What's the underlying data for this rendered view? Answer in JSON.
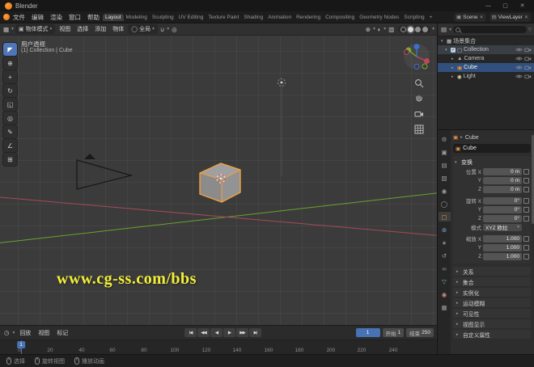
{
  "titlebar": {
    "app_title": "Blender",
    "minimize_glyph": "—",
    "maximize_glyph": "▢",
    "close_glyph": "✕"
  },
  "topbar": {
    "menus": [
      {
        "label": "文件"
      },
      {
        "label": "编辑"
      },
      {
        "label": "渲染"
      },
      {
        "label": "窗口"
      },
      {
        "label": "帮助"
      }
    ],
    "workspaces": [
      {
        "label": "Layout"
      },
      {
        "label": "Modeling"
      },
      {
        "label": "Sculpting"
      },
      {
        "label": "UV Editing"
      },
      {
        "label": "Texture Paint"
      },
      {
        "label": "Shading"
      },
      {
        "label": "Animation"
      },
      {
        "label": "Rendering"
      },
      {
        "label": "Compositing"
      },
      {
        "label": "Geometry Nodes"
      },
      {
        "label": "Scripting"
      }
    ],
    "active_workspace": "Layout",
    "add_workspace_glyph": "+",
    "scene_label": "Scene",
    "view_layer_label": "ViewLayer"
  },
  "viewport_header": {
    "mode_label": "物体模式",
    "menus": [
      {
        "label": "视图"
      },
      {
        "label": "选择"
      },
      {
        "label": "添加"
      },
      {
        "label": "物体"
      }
    ],
    "orientation_label": "全局"
  },
  "toolbar": {
    "tools": [
      {
        "name": "select-box",
        "glyph": "◤"
      },
      {
        "name": "cursor",
        "glyph": "⊕"
      },
      {
        "name": "move",
        "glyph": "+"
      },
      {
        "name": "rotate",
        "glyph": "↻"
      },
      {
        "name": "scale",
        "glyph": "◱"
      },
      {
        "name": "transform",
        "glyph": "◎"
      },
      {
        "name": "annotate",
        "glyph": "✎"
      },
      {
        "name": "measure",
        "glyph": "∠"
      },
      {
        "name": "add-primitive",
        "glyph": "⊞"
      }
    ]
  },
  "viewport": {
    "view_label": "用户透视",
    "context_label": "(1) Collection | Cube",
    "watermark": "www.cg-ss.com/bbs"
  },
  "outliner": {
    "rows": [
      {
        "label": "场景集合",
        "glyph": "▦"
      },
      {
        "label": "Collection",
        "glyph": "▢"
      },
      {
        "label": "Camera",
        "glyph": "▲"
      },
      {
        "label": "Cube",
        "glyph": "▣"
      },
      {
        "label": "Light",
        "glyph": "◉"
      }
    ]
  },
  "properties": {
    "tabs": [
      {
        "name": "tool",
        "glyph": "⚙"
      },
      {
        "name": "render",
        "glyph": "▣"
      },
      {
        "name": "output",
        "glyph": "▤"
      },
      {
        "name": "view-layer",
        "glyph": "▧"
      },
      {
        "name": "scene",
        "glyph": "◉"
      },
      {
        "name": "world",
        "glyph": "◯"
      },
      {
        "name": "object",
        "glyph": "▢"
      },
      {
        "name": "modifiers",
        "glyph": "⊛"
      },
      {
        "name": "particles",
        "glyph": "∗"
      },
      {
        "name": "physics",
        "glyph": "↺"
      },
      {
        "name": "constraints",
        "glyph": "∞"
      },
      {
        "name": "object-data",
        "glyph": "▽"
      },
      {
        "name": "material",
        "glyph": "◉"
      },
      {
        "name": "texture",
        "glyph": "▦"
      }
    ],
    "breadcrumb_object": "Cube",
    "name_value": "Cube",
    "transform_header": "变换",
    "rows": [
      {
        "label": "位置 X",
        "value": "0 m"
      },
      {
        "label": "Y",
        "value": "0 m"
      },
      {
        "label": "Z",
        "value": "0 m"
      },
      {
        "label": "旋转 X",
        "value": "0°"
      },
      {
        "label": "Y",
        "value": "0°"
      },
      {
        "label": "Z",
        "value": "0°"
      },
      {
        "label": "模式",
        "value": "XYZ 欧拉"
      },
      {
        "label": "缩放 X",
        "value": "1.000"
      },
      {
        "label": "Y",
        "value": "1.000"
      },
      {
        "label": "Z",
        "value": "1.000"
      }
    ],
    "sections": [
      {
        "label": "关系"
      },
      {
        "label": "集合"
      },
      {
        "label": "实例化"
      },
      {
        "label": "运动模糊"
      },
      {
        "label": "可见性"
      },
      {
        "label": "视图显示"
      },
      {
        "label": "自定义属性"
      }
    ]
  },
  "timeline": {
    "menus": [
      {
        "label": "回放"
      },
      {
        "label": "视图"
      },
      {
        "label": "标记"
      }
    ],
    "transport": [
      {
        "name": "jump-start",
        "glyph": "|◀"
      },
      {
        "name": "prev-keyframe",
        "glyph": "◀◀"
      },
      {
        "name": "play-reverse",
        "glyph": "◀"
      },
      {
        "name": "play",
        "glyph": "▶"
      },
      {
        "name": "next-keyframe",
        "glyph": "▶▶"
      },
      {
        "name": "jump-end",
        "glyph": "▶|"
      }
    ],
    "frame_current": "1",
    "start_label": "开始",
    "start_value": "1",
    "end_label": "结束",
    "end_value": "250",
    "ruler_ticks": [
      "0",
      "20",
      "40",
      "60",
      "80",
      "100",
      "120",
      "140",
      "160",
      "180",
      "200",
      "220",
      "240"
    ]
  },
  "statusbar": {
    "hints": [
      {
        "label": "选择"
      },
      {
        "label": "旋转视图"
      },
      {
        "label": "播放动画"
      }
    ]
  },
  "icons": {
    "editor_3d": "▦",
    "editor_outliner": "▤",
    "editor_timeline": "◷",
    "mode": "▣",
    "orientation_globe": "◯",
    "magnet": "∪",
    "proportional": "◎",
    "overlays": "◐",
    "xray": "▥",
    "gizmo_toggle": "⊕",
    "caret": "▾",
    "arrow_right": "▸",
    "arrow_down": "▾",
    "scene": "▣",
    "view_layer": "▤",
    "close_x": "✕",
    "filter": "▽",
    "check": "✓",
    "object_cube": "▣"
  },
  "colors": {
    "accent_blue": "#4772b3",
    "selection_orange": "#f0a13c",
    "axis_x_red": "#a8495a",
    "axis_y_green": "#6aa32c",
    "watermark_yellow": "#f4ef3a"
  }
}
